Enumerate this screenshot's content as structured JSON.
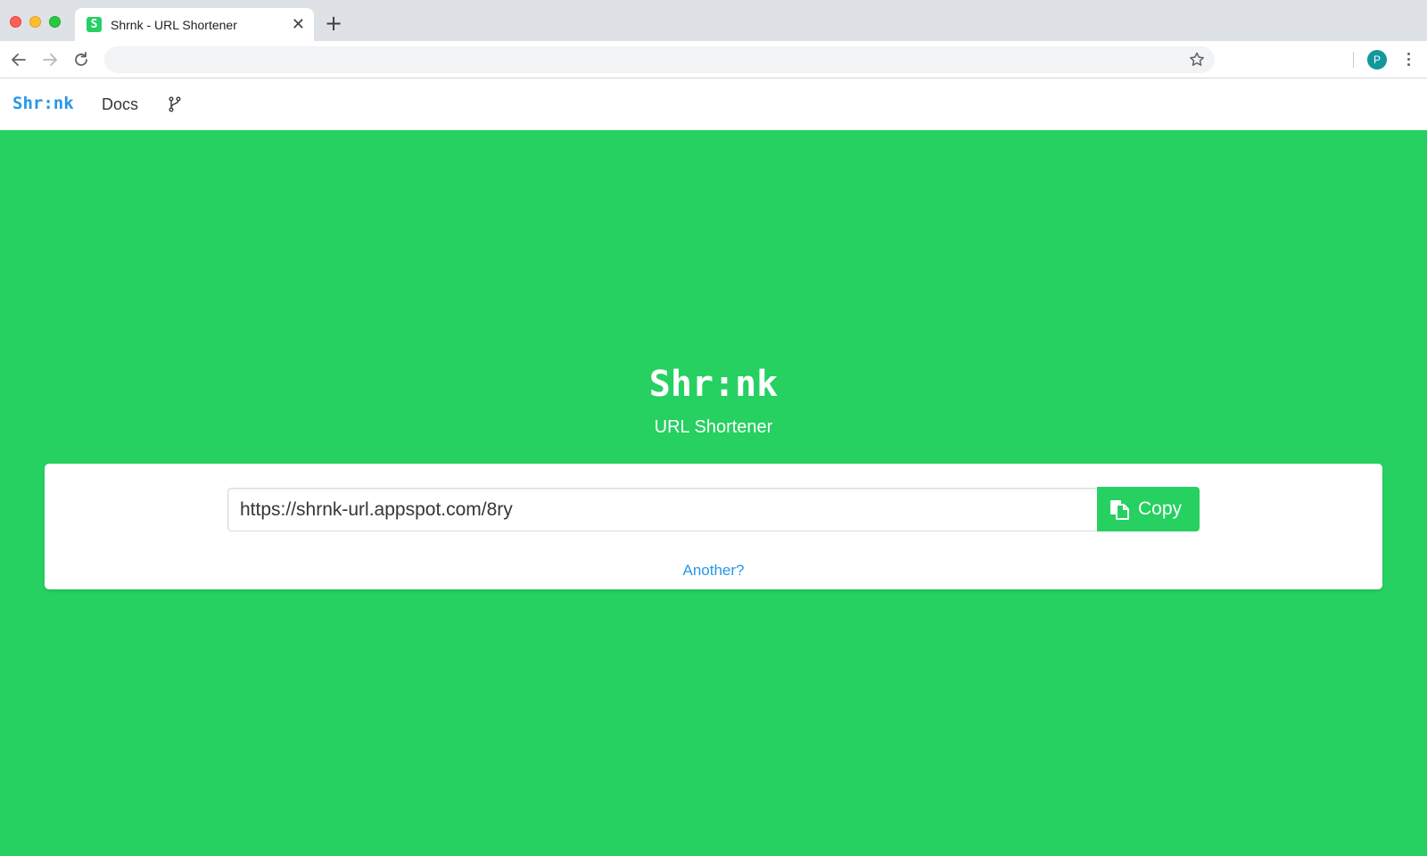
{
  "browser": {
    "tab_title": "Shrnk - URL Shortener",
    "favicon_letter": "S",
    "new_tab_symbol": "+",
    "close_symbol": "✕",
    "address_value": "",
    "profile_initial": "P"
  },
  "navbar": {
    "brand": "Shr:nk",
    "docs_label": "Docs",
    "fork_icon": "git-branch-icon"
  },
  "hero": {
    "title": "Shr:nk",
    "subtitle": "URL Shortener"
  },
  "result": {
    "short_url": "https://shrnk-url.appspot.com/8ry",
    "copy_label": "Copy",
    "another_label": "Another?"
  },
  "colors": {
    "brand_green": "#26d061",
    "link_blue": "#2897e6",
    "profile_teal": "#12979e"
  }
}
